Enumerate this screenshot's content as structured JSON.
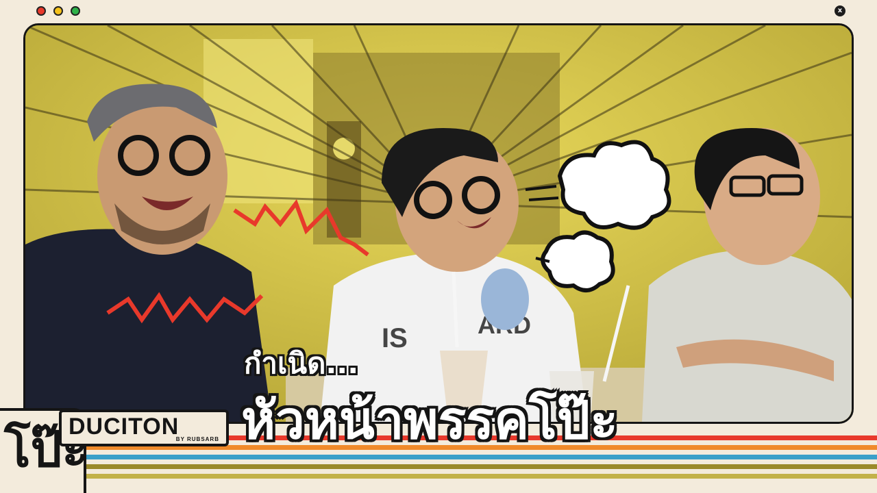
{
  "window": {
    "close_label": "x",
    "controls": [
      "close-dot",
      "minimize-dot",
      "maximize-dot"
    ]
  },
  "brand": {
    "logo_glyph": "โป๊ะ",
    "name": "DUCITON",
    "sub": "BY RUBSARB"
  },
  "caption": {
    "line1": "กำเนิด...",
    "line2": "หัวหน้าพรรคโป๊ะ"
  },
  "colors": {
    "background": "#f3ebdc",
    "frame_border": "#151515",
    "scene_tint": "#c7b73e",
    "accent_red": "#e8392b",
    "stripe_1": "#e8392b",
    "stripe_2": "#f08a2a",
    "stripe_3": "#3aa0c9",
    "stripe_4": "#9a8a2a"
  }
}
